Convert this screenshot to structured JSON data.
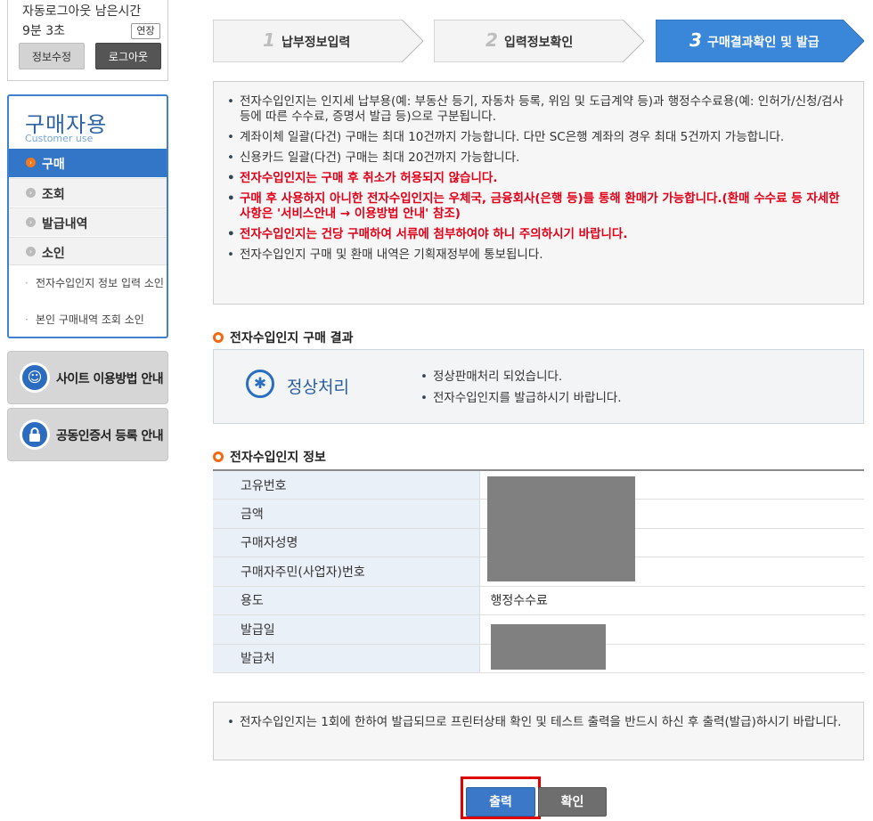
{
  "session": {
    "remaining_label": "자동로그아웃 남은시간",
    "remaining_time": "9분 3초",
    "extend_label": "연장",
    "edit_label": "정보수정",
    "logout_label": "로그아웃"
  },
  "sidebar": {
    "title": "구매자용",
    "subtitle": "Customer use",
    "items": [
      {
        "label": "구매",
        "active": true
      },
      {
        "label": "조회"
      },
      {
        "label": "발급내역"
      },
      {
        "label": "소인"
      }
    ],
    "subitems": [
      {
        "label": "전자수입인지 정보 입력 소인"
      },
      {
        "label": "본인 구매내역 조회 소인"
      }
    ]
  },
  "guides": [
    {
      "label": "사이트 이용방법 안내",
      "icon": "headset-icon"
    },
    {
      "label": "공동인증서 등록 안내",
      "icon": "lock-icon"
    }
  ],
  "steps": [
    {
      "num": "1",
      "label": "납부정보입력",
      "active": false
    },
    {
      "num": "2",
      "label": "입력정보확인",
      "active": false
    },
    {
      "num": "3",
      "label": "구매결과확인 및 발급",
      "active": true
    }
  ],
  "notice": [
    {
      "text": "전자수입인지는 인지세 납부용(예: 부동산 등기, 자동차 등록, 위임 및 도급계약 등)과 행정수수료용(예: 인허가/신청/검사 등에 따른 수수료, 증명서 발급 등)으로 구분됩니다.",
      "warn": false
    },
    {
      "text": "계좌이체 일괄(다건) 구매는 최대 10건까지 가능합니다. 다만 SC은행 계좌의 경우 최대 5건까지 가능합니다.",
      "warn": false
    },
    {
      "text": "신용카드 일괄(다건) 구매는 최대 20건까지 가능합니다.",
      "warn": false
    },
    {
      "text": "전자수입인지는 구매 후 취소가 허용되지 않습니다.",
      "warn": true
    },
    {
      "text": "구매 후 사용하지 아니한 전자수입인지는 우체국, 금융회사(은행 등)를 통해 환매가 가능합니다.(환매 수수료 등 자세한 사항은 '서비스안내 → 이용방법 안내' 참조)",
      "warn": true
    },
    {
      "text": "전자수입인지는 건당 구매하여 서류에 첨부하여야 하니 주의하시기 바랍니다.",
      "warn": true
    },
    {
      "text": "전자수입인지 구매 및 환매 내역은 기획재정부에 통보됩니다.",
      "warn": false
    }
  ],
  "result_section": {
    "title": "전자수입인지 구매 결과",
    "status": "정상처리",
    "messages": [
      "정상판매처리 되었습니다.",
      "전자수입인지를 발급하시기 바랍니다."
    ]
  },
  "info_section": {
    "title": "전자수입인지 정보",
    "rows": [
      {
        "label": "고유번호",
        "value": ""
      },
      {
        "label": "금액",
        "value": ""
      },
      {
        "label": "구매자성명",
        "value": ""
      },
      {
        "label": "구매자주민(사업자)번호",
        "value": ""
      },
      {
        "label": "용도",
        "value": "행정수수료"
      },
      {
        "label": "발급일",
        "value": ""
      },
      {
        "label": "발급처",
        "value": ""
      }
    ]
  },
  "bottom_note": "전자수입인지는 1회에 한하여 발급되므로 프린터상태 확인 및 테스트 출력을 반드시 하신 후 출력(발급)하시기 바랍니다.",
  "buttons": {
    "print": "출력",
    "confirm": "확인"
  },
  "colors": {
    "accent": "#3375c7",
    "warning": "#e00018",
    "bullet_ring": "#f06a14",
    "highlight_border": "#e10000"
  }
}
